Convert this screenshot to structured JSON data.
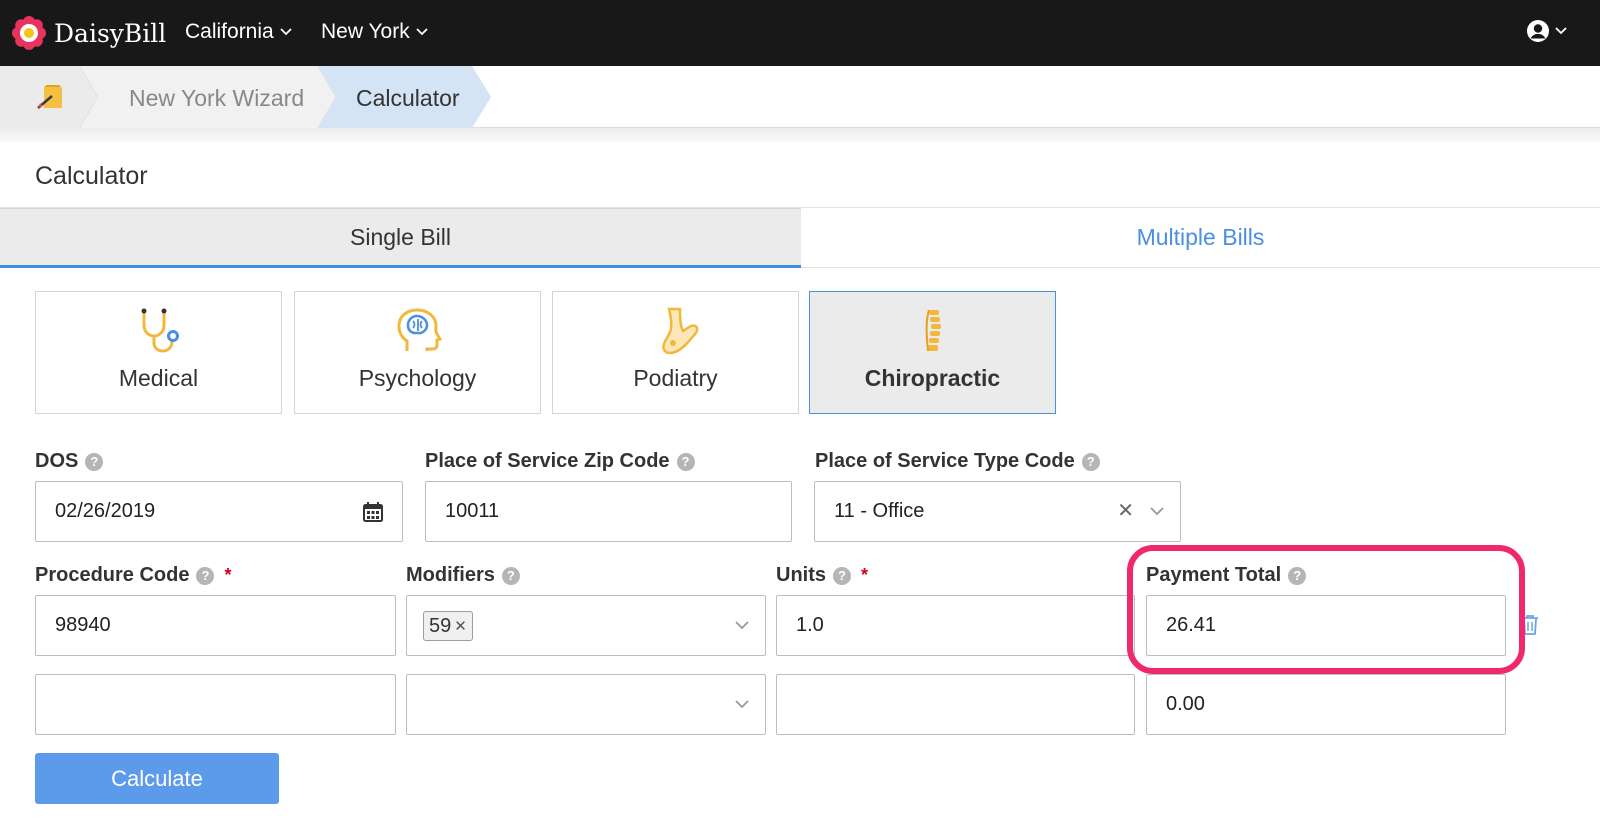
{
  "brand": {
    "name": "DaisyBill"
  },
  "nav": {
    "states": [
      {
        "label": "California",
        "icon": "chevron-down-icon"
      },
      {
        "label": "New York",
        "icon": "chevron-down-icon"
      }
    ],
    "user_icon": "user-circle-icon"
  },
  "breadcrumb": {
    "home_icon": "pencil-note-icon",
    "items": [
      "New York Wizard",
      "Calculator"
    ]
  },
  "page": {
    "title": "Calculator"
  },
  "tabs": [
    {
      "label": "Single Bill",
      "active": true
    },
    {
      "label": "Multiple Bills",
      "active": false
    }
  ],
  "specialties": [
    {
      "label": "Medical",
      "icon": "stethoscope-icon"
    },
    {
      "label": "Psychology",
      "icon": "brain-head-icon"
    },
    {
      "label": "Podiatry",
      "icon": "foot-icon"
    },
    {
      "label": "Chiropractic",
      "icon": "spine-icon",
      "active": true
    }
  ],
  "form": {
    "dos": {
      "label": "DOS",
      "value": "02/26/2019"
    },
    "zip": {
      "label": "Place of Service Zip Code",
      "value": "10011"
    },
    "pos_type": {
      "label": "Place of Service Type Code",
      "value": "11 - Office"
    },
    "columns": {
      "procedure": "Procedure Code",
      "modifiers": "Modifiers",
      "units": "Units",
      "payment": "Payment Total"
    },
    "rows": [
      {
        "procedure": "98940",
        "modifiers": [
          "59"
        ],
        "units": "1.0",
        "payment": "26.41"
      },
      {
        "procedure": "",
        "modifiers": [],
        "units": "",
        "payment": "0.00"
      }
    ],
    "required_mark": "*",
    "help_mark": "?"
  },
  "actions": {
    "calculate": "Calculate"
  },
  "colors": {
    "accent": "#4a90e2",
    "highlight": "#f0296e",
    "nav_bg": "#181818",
    "button": "#5b9bea"
  }
}
